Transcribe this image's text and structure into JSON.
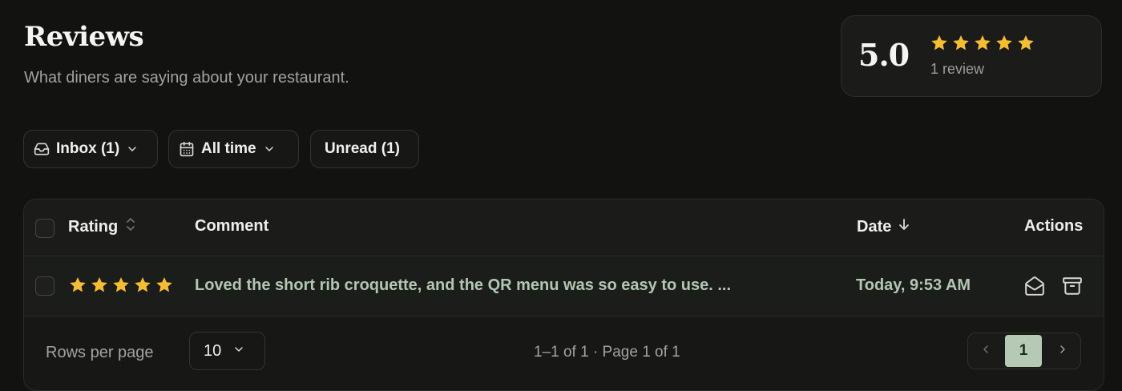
{
  "header": {
    "title": "Reviews",
    "subtitle": "What diners are saying about your restaurant."
  },
  "summary": {
    "score": "5.0",
    "stars": 5,
    "count_label": "1 review"
  },
  "filters": {
    "inbox_label": "Inbox (1)",
    "time_label": "All time",
    "unread_label": "Unread (1)"
  },
  "table": {
    "columns": {
      "rating": "Rating",
      "comment": "Comment",
      "date": "Date",
      "actions": "Actions"
    },
    "rows": [
      {
        "rating": 5,
        "comment": "Loved the short rib croquette, and the QR menu was so easy to use. ...",
        "date": "Today, 9:53 AM"
      }
    ]
  },
  "footer": {
    "rows_per_page_label": "Rows per page",
    "rows_per_page_value": "10",
    "page_info": "1–1 of 1 · Page 1 of 1",
    "current_page": "1"
  },
  "colors": {
    "background": "#121211",
    "star": "#f5bd33",
    "accent": "#b6c9b5",
    "comment_text": "#b2c7b2"
  }
}
